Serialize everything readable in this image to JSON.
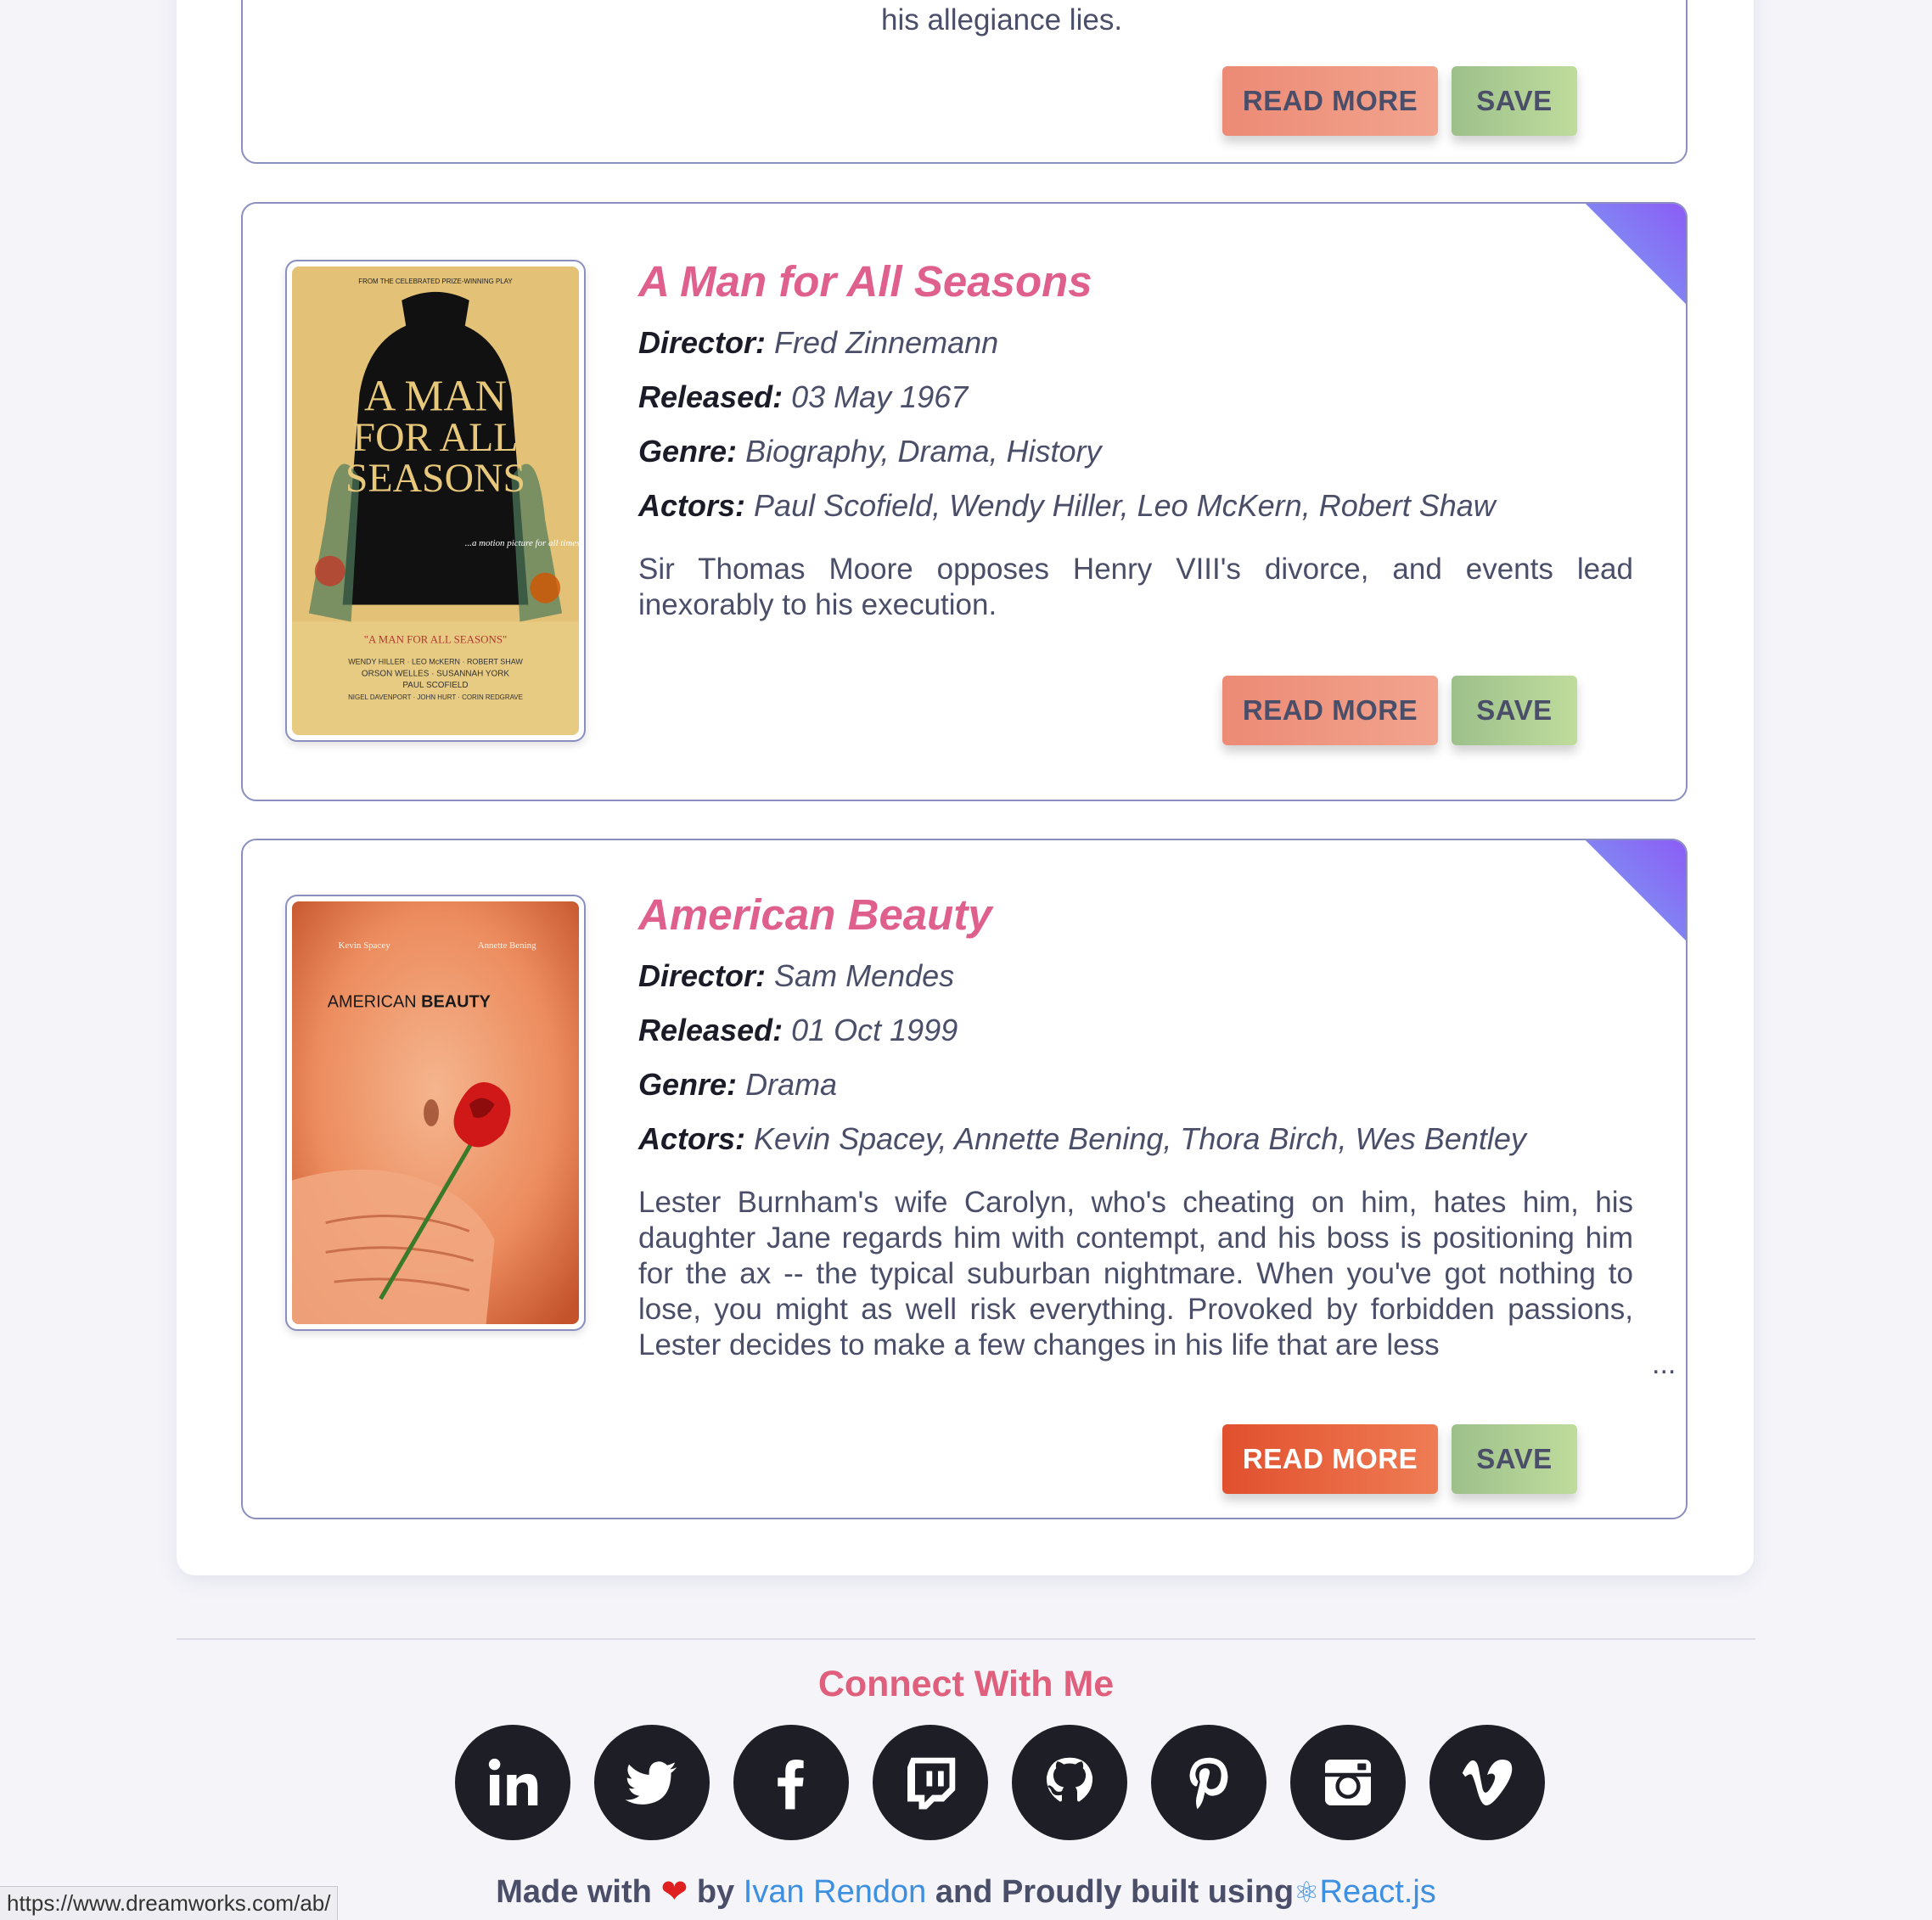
{
  "previous_card": {
    "plot_tail": "his allegiance lies.",
    "read_more_label": "READ MORE",
    "save_label": "SAVE"
  },
  "movies": [
    {
      "title": "A Man for All Seasons",
      "director_label": "Director:",
      "director": "Fred Zinnemann",
      "released_label": "Released:",
      "released": "03 May 1967",
      "genre_label": "Genre:",
      "genre": "Biography, Drama, History",
      "actors_label": "Actors:",
      "actors": "Paul Scofield, Wendy Hiller, Leo McKern, Robert Shaw",
      "plot": "Sir Thomas Moore opposes Henry VIII's divorce, and events lead inexorably to his execution.",
      "read_more_label": "READ MORE",
      "save_label": "SAVE",
      "poster_text": {
        "top": "FROM THE CELEBRATED PRIZE-WINNING PLAY",
        "main1": "A MAN",
        "main2": "FOR ALL",
        "main3": "SEASONS",
        "tagline": "...a motion picture for all times!",
        "credits1": "\"A MAN FOR ALL SEASONS\"",
        "credits2": "WENDY HILLER · LEO McKERN · ROBERT SHAW",
        "credits3": "ORSON WELLES · SUSANNAH YORK",
        "credits4": "PAUL SCOFIELD",
        "credits5": "NIGEL DAVENPORT · JOHN HURT · CORIN REDGRAVE"
      }
    },
    {
      "title": "American Beauty",
      "director_label": "Director:",
      "director": "Sam Mendes",
      "released_label": "Released:",
      "released": "01 Oct 1999",
      "genre_label": "Genre:",
      "genre": "Drama",
      "actors_label": "Actors:",
      "actors": "Kevin Spacey, Annette Bening, Thora Birch, Wes Bentley",
      "plot": "Lester Burnham's wife Carolyn, who's cheating on him, hates him, his daughter Jane regards him with contempt, and his boss is positioning him for the ax -- the typical suburban nightmare. When you've got nothing to lose, you might as well risk everything. Provoked by forbidden passions, Lester decides to make a few changes in his life that are less",
      "ellipsis": "...",
      "read_more_label": "READ MORE",
      "save_label": "SAVE",
      "poster_text": {
        "actor1": "Kevin Spacey",
        "actor2": "Annette Bening",
        "title_plain": "AMERICAN ",
        "title_bold": "BEAUTY"
      }
    }
  ],
  "footer": {
    "connect_heading": "Connect With Me",
    "socials": [
      "linkedin-icon",
      "twitter-icon",
      "facebook-icon",
      "twitch-icon",
      "github-icon",
      "pinterest-icon",
      "instagram-icon",
      "vimeo-icon"
    ],
    "made_with": "Made with",
    "by": "by",
    "author": "Ivan Rendon",
    "built_using": "and Proudly built using",
    "tech": "React.js"
  },
  "status_bar_url": "https://www.dreamworks.com/ab/"
}
